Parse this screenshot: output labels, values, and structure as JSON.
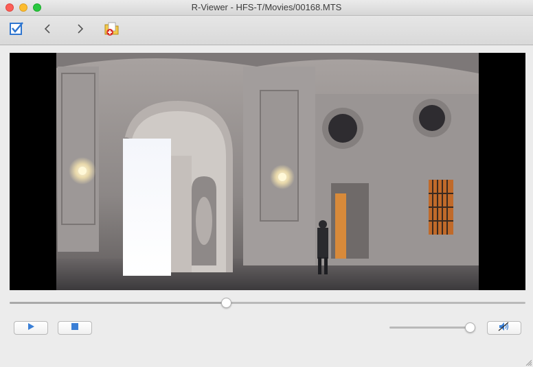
{
  "window": {
    "title": "R-Viewer - HFS-T/Movies/00168.MTS"
  },
  "toolbar": {
    "items": [
      {
        "icon": "checkbox-checked-icon"
      },
      {
        "icon": "chevron-left-icon"
      },
      {
        "icon": "chevron-right-icon"
      },
      {
        "icon": "folder-add-icon"
      }
    ]
  },
  "player": {
    "seek_position": 0.42,
    "volume": 0.94,
    "muted": true,
    "controls": [
      {
        "icon": "play-icon"
      },
      {
        "icon": "stop-icon"
      },
      {
        "icon": "speaker-muted-icon"
      }
    ]
  },
  "colors": {
    "accent": "#2f76d0",
    "control_icon": "#3a7fd6"
  }
}
